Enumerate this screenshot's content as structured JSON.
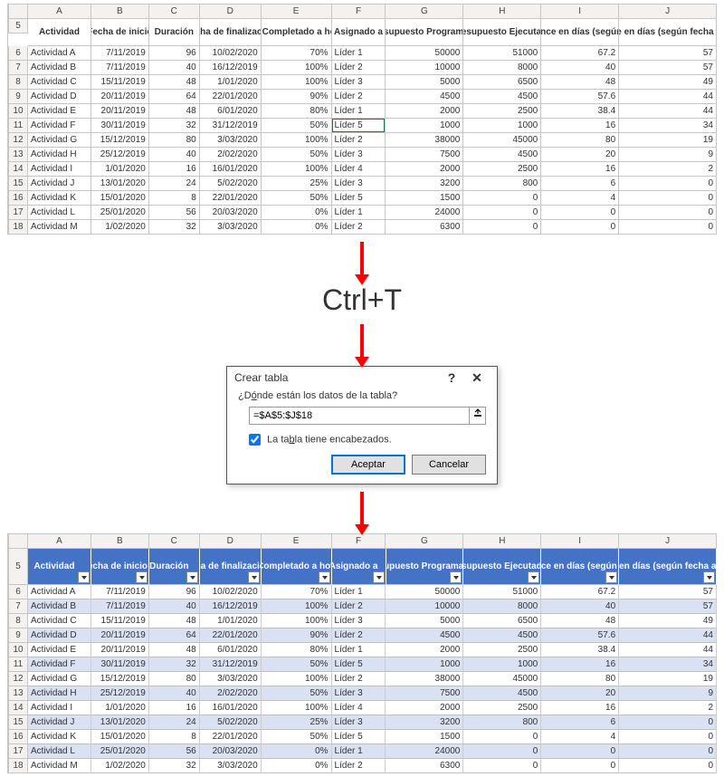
{
  "columns_letters": [
    "A",
    "B",
    "C",
    "D",
    "E",
    "F",
    "G",
    "H",
    "I",
    "J"
  ],
  "headers": [
    "Actividad",
    "Fecha de inicio",
    "Duración",
    "Fecha de finalización",
    "% Completado a hoy",
    "Asignado a",
    "Presupuesto Programado",
    "Presupuesto Ejecutado",
    "Avance en días (según %)",
    "Avance en días (según fecha actual)"
  ],
  "rows": [
    {
      "n": 6,
      "c": [
        "Actividad A",
        "7/11/2019",
        "96",
        "10/02/2020",
        "70%",
        "Líder 1",
        "50000",
        "51000",
        "67.2",
        "57"
      ]
    },
    {
      "n": 7,
      "c": [
        "Actividad B",
        "7/11/2019",
        "40",
        "16/12/2019",
        "100%",
        "Líder 2",
        "10000",
        "8000",
        "40",
        "57"
      ]
    },
    {
      "n": 8,
      "c": [
        "Actividad C",
        "15/11/2019",
        "48",
        "1/01/2020",
        "100%",
        "Líder 3",
        "5000",
        "6500",
        "48",
        "49"
      ]
    },
    {
      "n": 9,
      "c": [
        "Actividad D",
        "20/11/2019",
        "64",
        "22/01/2020",
        "90%",
        "Líder 2",
        "4500",
        "4500",
        "57.6",
        "44"
      ]
    },
    {
      "n": 10,
      "c": [
        "Actividad E",
        "20/11/2019",
        "48",
        "6/01/2020",
        "80%",
        "Líder 1",
        "2000",
        "2500",
        "38.4",
        "44"
      ]
    },
    {
      "n": 11,
      "c": [
        "Actividad F",
        "30/11/2019",
        "32",
        "31/12/2019",
        "50%",
        "Líder 5",
        "1000",
        "1000",
        "16",
        "34"
      ]
    },
    {
      "n": 12,
      "c": [
        "Actividad G",
        "15/12/2019",
        "80",
        "3/03/2020",
        "100%",
        "Líder 2",
        "38000",
        "45000",
        "80",
        "19"
      ]
    },
    {
      "n": 13,
      "c": [
        "Actividad H",
        "25/12/2019",
        "40",
        "2/02/2020",
        "50%",
        "Líder 3",
        "7500",
        "4500",
        "20",
        "9"
      ]
    },
    {
      "n": 14,
      "c": [
        "Actividad I",
        "1/01/2020",
        "16",
        "16/01/2020",
        "100%",
        "Líder 4",
        "2000",
        "2500",
        "16",
        "2"
      ]
    },
    {
      "n": 15,
      "c": [
        "Actividad J",
        "13/01/2020",
        "24",
        "5/02/2020",
        "25%",
        "Líder 3",
        "3200",
        "800",
        "6",
        "0"
      ]
    },
    {
      "n": 16,
      "c": [
        "Actividad K",
        "15/01/2020",
        "8",
        "22/01/2020",
        "50%",
        "Líder 5",
        "1500",
        "0",
        "4",
        "0"
      ]
    },
    {
      "n": 17,
      "c": [
        "Actividad L",
        "25/01/2020",
        "56",
        "20/03/2020",
        "0%",
        "Líder 1",
        "24000",
        "0",
        "0",
        "0"
      ]
    },
    {
      "n": 18,
      "c": [
        "Actividad M",
        "1/02/2020",
        "32",
        "3/03/2020",
        "0%",
        "Líder 2",
        "6300",
        "0",
        "0",
        "0"
      ]
    }
  ],
  "shortcut_label": "Ctrl+T",
  "dialog": {
    "title": "Crear tabla",
    "prompt_html": "¿D<u>ó</u>nde están los datos de la tabla?",
    "input_value": "=$A$5:$J$18",
    "checkbox_label_html": "La ta<u>b</u>la tiene encabezados.",
    "accept": "Aceptar",
    "cancel": "Cancelar"
  },
  "header_row_number": "5"
}
